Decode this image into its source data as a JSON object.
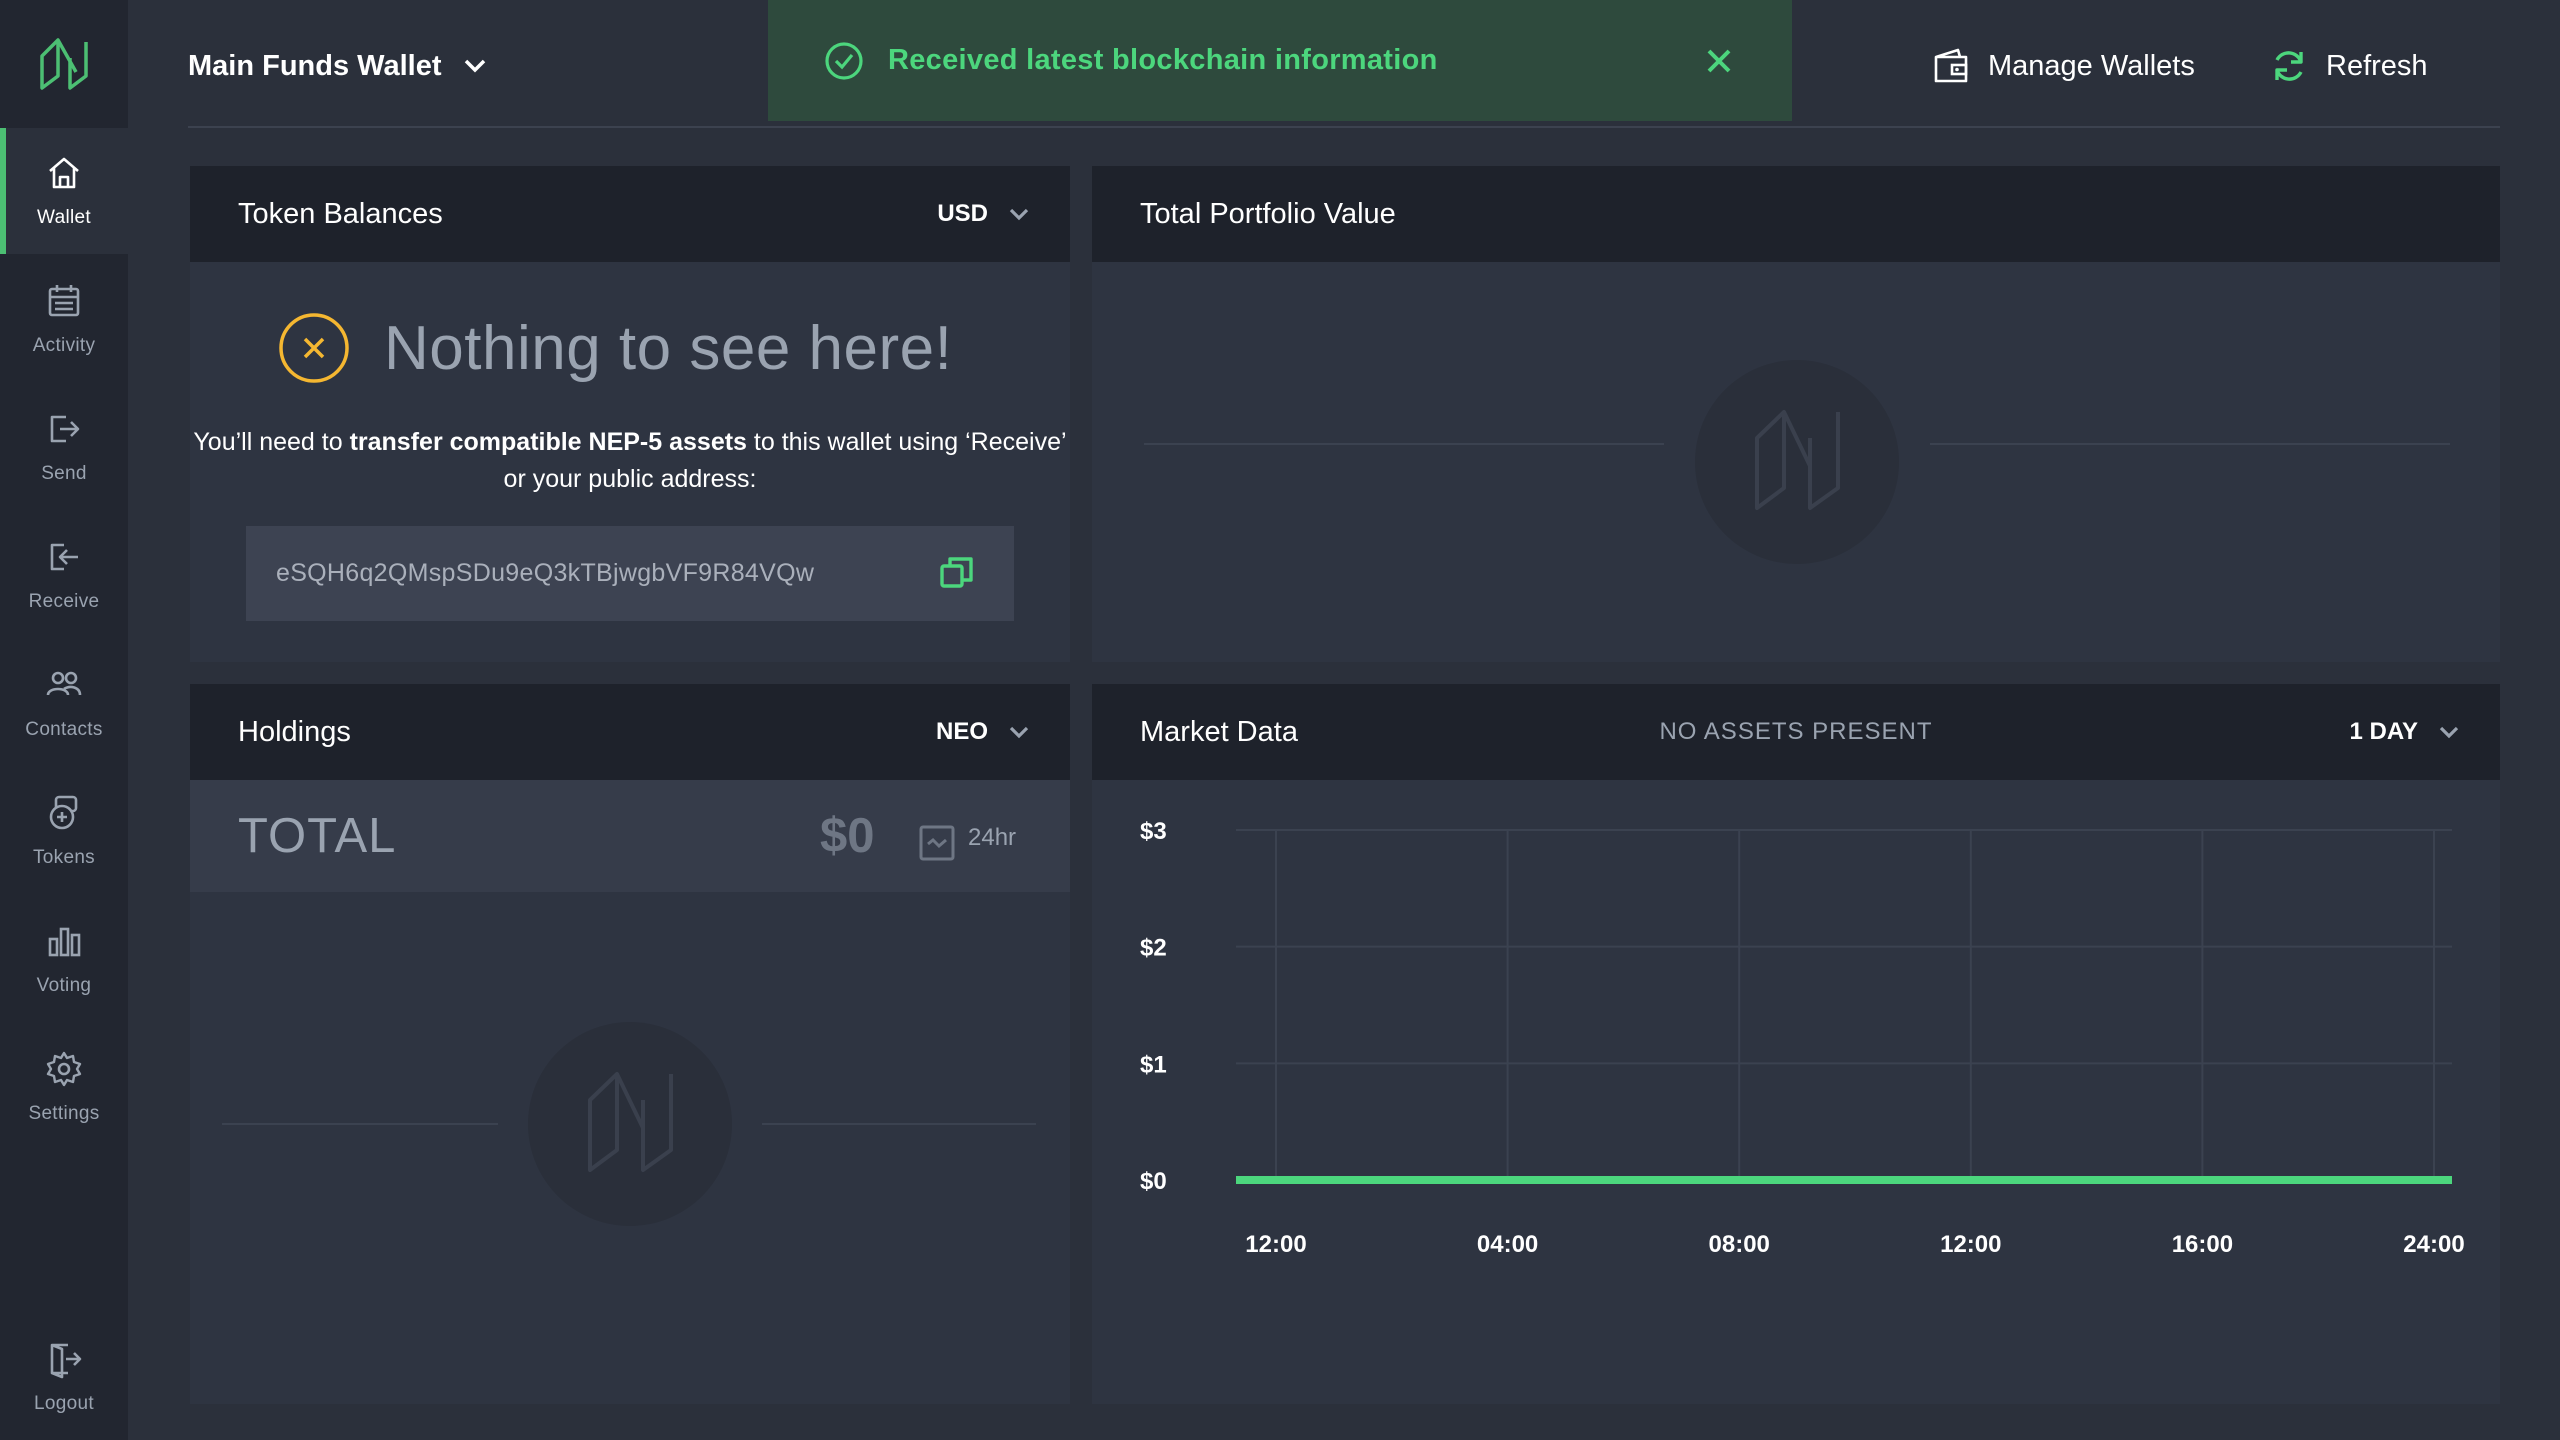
{
  "sidebar": {
    "items": [
      {
        "label": "Wallet",
        "icon": "home-icon",
        "active": true
      },
      {
        "label": "Activity",
        "icon": "calendar-icon"
      },
      {
        "label": "Send",
        "icon": "send-icon"
      },
      {
        "label": "Receive",
        "icon": "receive-icon"
      },
      {
        "label": "Contacts",
        "icon": "contacts-icon"
      },
      {
        "label": "Tokens",
        "icon": "tokens-icon"
      },
      {
        "label": "Voting",
        "icon": "voting-icon"
      },
      {
        "label": "Settings",
        "icon": "gear-icon"
      }
    ],
    "logout_label": "Logout"
  },
  "header": {
    "wallet_name": "Main Funds Wallet",
    "manage_wallets_label": "Manage Wallets",
    "refresh_label": "Refresh"
  },
  "toast": {
    "message": "Received latest blockchain information"
  },
  "token_balances": {
    "title": "Token Balances",
    "currency": "USD",
    "empty_title": "Nothing to see here!",
    "desc_before": "You’ll need to ",
    "desc_bold": "transfer compatible NEP-5 assets",
    "desc_after": " to this wallet using ‘Receive’ or your public address:",
    "address": "eSQH6q2QMspSDu9eQ3kTBjwgbVF9R84VQw"
  },
  "portfolio": {
    "title": "Total Portfolio Value"
  },
  "holdings": {
    "title": "Holdings",
    "token": "NEO",
    "total_label": "TOTAL",
    "total_value": "$0",
    "period": "24hr"
  },
  "market": {
    "title": "Market Data",
    "status": "NO ASSETS PRESENT",
    "range": "1 DAY"
  },
  "colors": {
    "accent": "#4cbf73",
    "toast_text": "#4cd67d",
    "warning": "#f5b731",
    "panel_bg": "#2e3441",
    "panel_head": "#1e222b"
  },
  "chart_data": {
    "type": "line",
    "x": [
      "12:00",
      "04:00",
      "08:00",
      "12:00",
      "16:00",
      "24:00"
    ],
    "series": [
      {
        "values": [
          0,
          0,
          0,
          0,
          0,
          0
        ]
      }
    ],
    "yticks": [
      "$0",
      "$1",
      "$2",
      "$3"
    ],
    "ylim": [
      0,
      3
    ],
    "grid": true,
    "line_color": "#4cd67d"
  }
}
